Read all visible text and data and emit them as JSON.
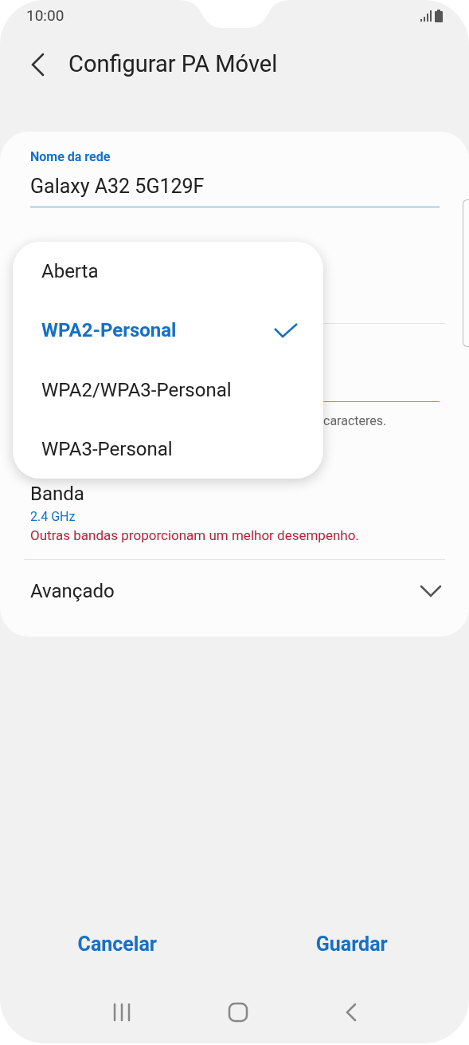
{
  "status_bar": {
    "time": "10:00"
  },
  "header": {
    "title": "Configurar PA Móvel"
  },
  "network_name": {
    "label": "Nome da rede",
    "value": "Galaxy A32 5G129F"
  },
  "password_hint": "caracteres.",
  "band": {
    "label": "Banda",
    "value": "2.4 GHz",
    "warning": "Outras bandas proporcionam um melhor desempenho."
  },
  "advanced": {
    "label": "Avançado",
    "expanded": false
  },
  "security_menu": [
    {
      "label": "Aberta",
      "selected": false
    },
    {
      "label": "WPA2-Personal",
      "selected": true
    },
    {
      "label": "WPA2/WPA3-Personal",
      "selected": false
    },
    {
      "label": "WPA3-Personal",
      "selected": false
    }
  ],
  "buttons": [
    {
      "label": "Cancelar"
    },
    {
      "label": "Guardar"
    }
  ]
}
